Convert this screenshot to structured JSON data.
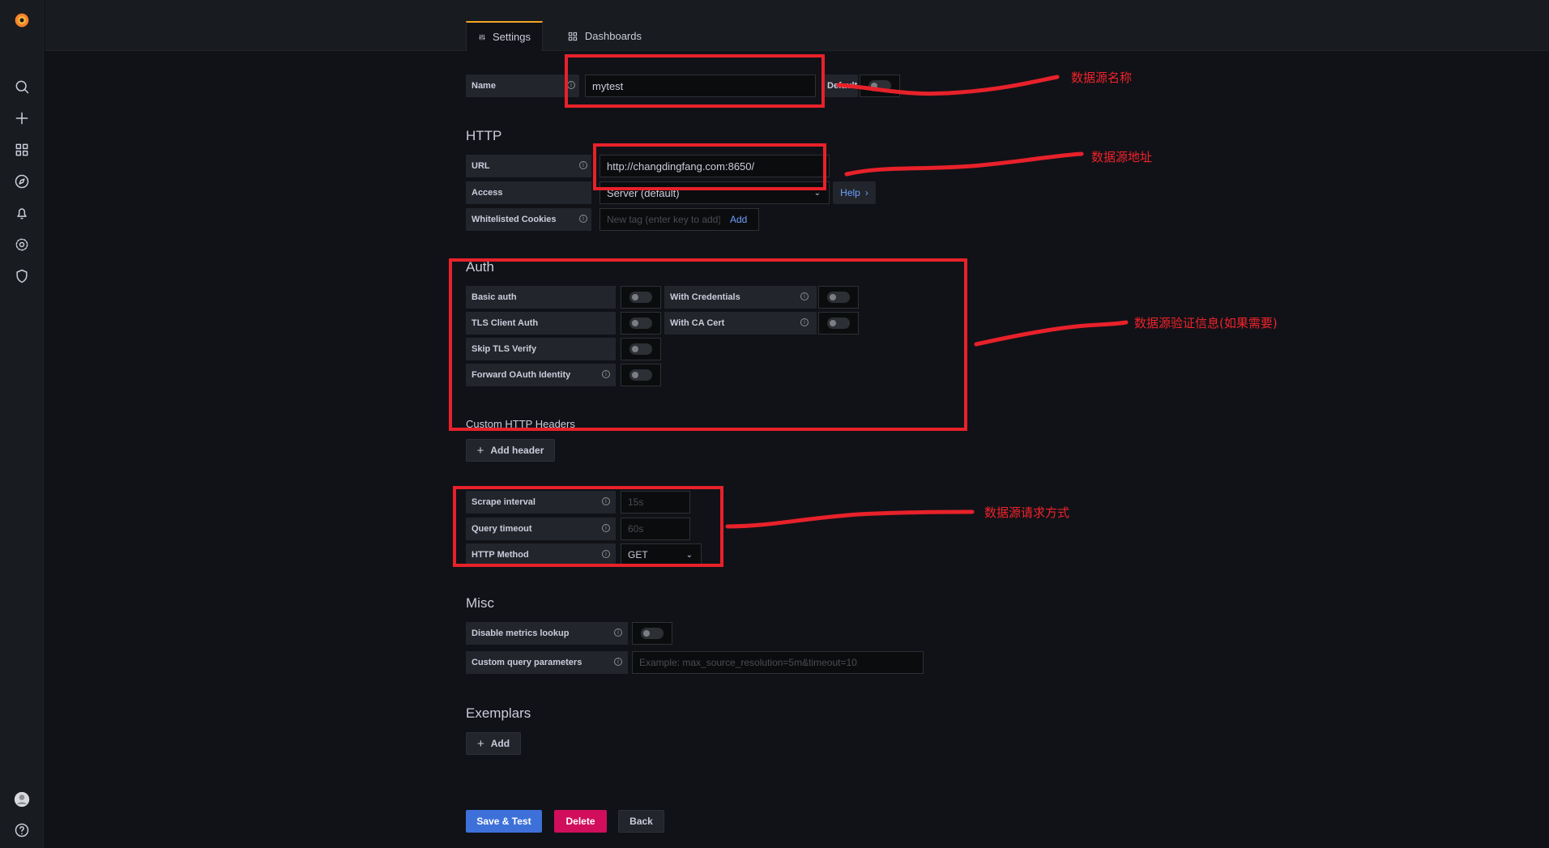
{
  "tabs": {
    "settings": "Settings",
    "dashboards": "Dashboards"
  },
  "name": {
    "label": "Name",
    "value": "mytest",
    "default_label": "Default"
  },
  "http": {
    "title": "HTTP",
    "url_label": "URL",
    "url_value": "http://changdingfang.com:8650/",
    "access_label": "Access",
    "access_value": "Server (default)",
    "help": "Help",
    "cookies_label": "Whitelisted Cookies",
    "cookies_placeholder": "New tag (enter key to add)",
    "cookies_add": "Add"
  },
  "auth": {
    "title": "Auth",
    "basic": "Basic auth",
    "with_credentials": "With Credentials",
    "tls_client": "TLS Client Auth",
    "with_ca": "With CA Cert",
    "skip_tls": "Skip TLS Verify",
    "forward_oauth": "Forward OAuth Identity"
  },
  "headers": {
    "title": "Custom HTTP Headers",
    "add_label": "Add header"
  },
  "prom": {
    "scrape_label": "Scrape interval",
    "scrape_placeholder": "15s",
    "timeout_label": "Query timeout",
    "timeout_placeholder": "60s",
    "method_label": "HTTP Method",
    "method_value": "GET"
  },
  "misc": {
    "title": "Misc",
    "disable_metrics": "Disable metrics lookup",
    "custom_query": "Custom query parameters",
    "custom_query_placeholder": "Example: max_source_resolution=5m&timeout=10"
  },
  "exemplars": {
    "title": "Exemplars",
    "add": "Add"
  },
  "buttons": {
    "save": "Save & Test",
    "delete": "Delete",
    "back": "Back"
  },
  "annotations": {
    "name_note": "数据源名称",
    "url_note": "数据源地址",
    "auth_note": "数据源验证信息(如果需要)",
    "method_note": "数据源请求方式"
  },
  "colors": {
    "accent": "#f5a524",
    "primary": "#3d71d9",
    "danger": "#d10e5c",
    "annotation": "#e8212a"
  }
}
